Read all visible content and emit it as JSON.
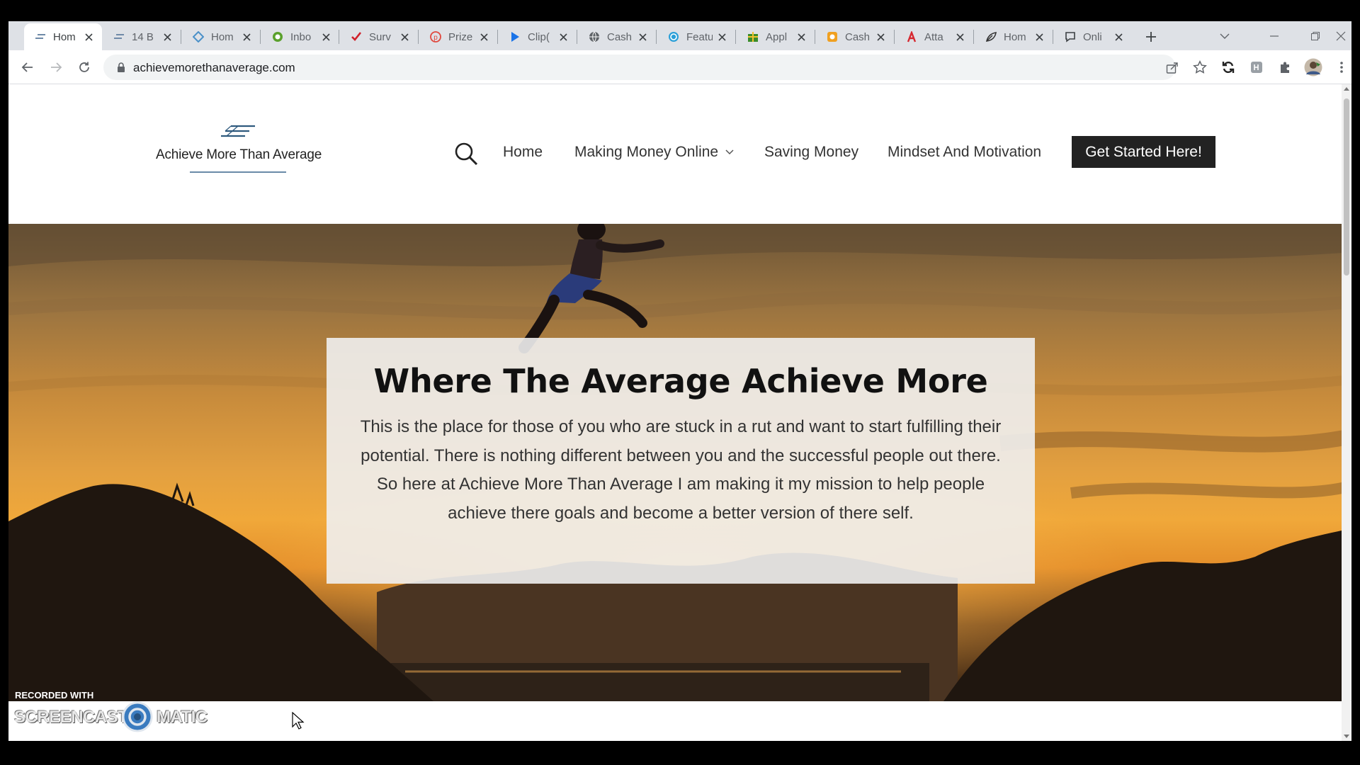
{
  "browser": {
    "tabs": [
      {
        "title": "Hom",
        "icon": "achieve-logo-icon",
        "active": true
      },
      {
        "title": "14 B",
        "icon": "achieve-logo-icon"
      },
      {
        "title": "Hom",
        "icon": "blue-diamond-icon"
      },
      {
        "title": "Inbo",
        "icon": "green-circle-icon"
      },
      {
        "title": "Surv",
        "icon": "red-checkmark-icon"
      },
      {
        "title": "Prize",
        "icon": "red-p-circle-icon"
      },
      {
        "title": "Clip(",
        "icon": "blue-play-icon"
      },
      {
        "title": "Cash",
        "icon": "globe-icon"
      },
      {
        "title": "Featu",
        "icon": "blue-circle-icon"
      },
      {
        "title": "Appl",
        "icon": "gift-icon"
      },
      {
        "title": "Cash",
        "icon": "orange-square-icon"
      },
      {
        "title": "Atta",
        "icon": "red-a-icon"
      },
      {
        "title": "Hom",
        "icon": "leaf-icon"
      },
      {
        "title": "Onli",
        "icon": "speech-bubble-icon"
      }
    ],
    "url": "achievemorethanaverage.com"
  },
  "site": {
    "logo_text": "Achieve More Than Average",
    "nav": [
      {
        "label": "Home"
      },
      {
        "label": "Making Money Online",
        "has_dropdown": true
      },
      {
        "label": "Saving Money"
      },
      {
        "label": "Mindset And Motivation"
      }
    ],
    "cta_label": "Get Started Here!",
    "hero": {
      "title": "Where The Average Achieve More",
      "text": "This is the place for those of you who are stuck in a rut and want to start fulfilling their potential. There is nothing different between you and the successful people out there. So here at Achieve More Than Average I am making it my mission to help people achieve there goals and become a better version of there self."
    }
  },
  "watermark": {
    "recorded_with": "RECORDED WITH",
    "brand_left": "SCREENCAST",
    "brand_right": "MATIC"
  },
  "colors": {
    "tabstrip": "#dee1e6",
    "cta_background": "#222222",
    "hero_sky": "#e3a040"
  }
}
